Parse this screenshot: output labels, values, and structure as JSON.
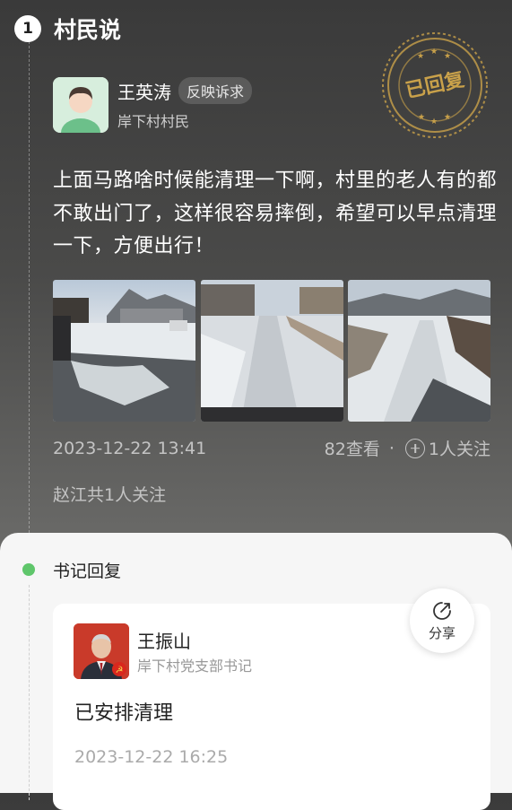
{
  "section": {
    "number": "1",
    "title": "村民说"
  },
  "stamp": {
    "text": "已回复"
  },
  "post": {
    "author_name": "王英涛",
    "author_tag": "反映诉求",
    "author_role": "岸下村村民",
    "text": "上面马路啥时候能清理一下啊，村里的老人有的都不敢出门了，这样很容易摔倒，希望可以早点清理一下，方便出行！",
    "date": "2023-12-22 13:41",
    "views": "82查看",
    "separator": "·",
    "follow_label": "1人关注",
    "follow_note": "赵江共1人关注"
  },
  "reply": {
    "header": "书记回复",
    "name": "王振山",
    "role": "岸下村党支部书记",
    "text": "已安排清理",
    "date": "2023-12-22 16:25"
  },
  "share": {
    "label": "分享"
  },
  "colors": {
    "accent_green": "#5fc66b",
    "stamp_gold": "#c9a14a"
  }
}
